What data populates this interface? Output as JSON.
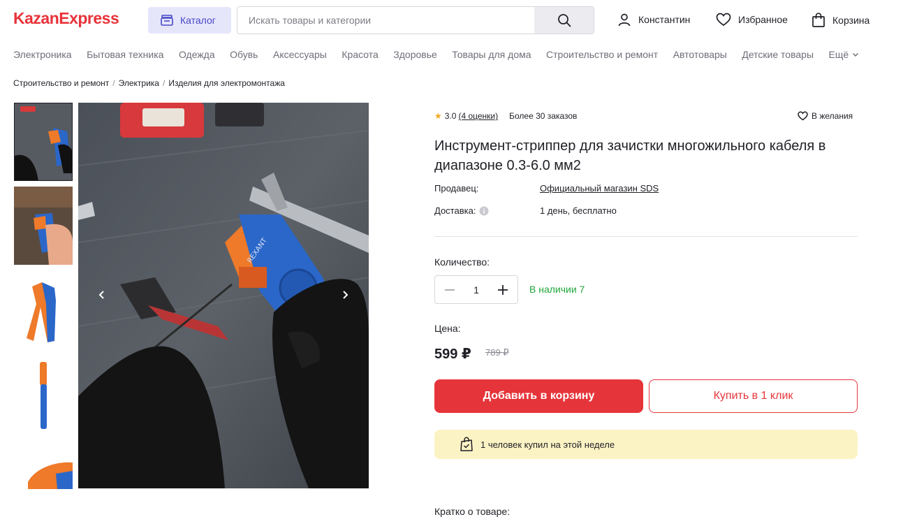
{
  "header": {
    "logo": "KazanExpress",
    "catalog_label": "Каталог",
    "search_placeholder": "Искать товары и категории",
    "user_label": "Константин",
    "favorites_label": "Избранное",
    "cart_label": "Корзина"
  },
  "nav": {
    "items": [
      "Электроника",
      "Бытовая техника",
      "Одежда",
      "Обувь",
      "Аксессуары",
      "Красота",
      "Здоровье",
      "Товары для дома",
      "Строительство и ремонт",
      "Автотовары",
      "Детские товары"
    ],
    "more_label": "Ещё"
  },
  "breadcrumb": [
    "Строительство и ремонт",
    "Электрика",
    "Изделия для электромонтажа"
  ],
  "product": {
    "rating": "3.0",
    "reviews": "(4 оценки)",
    "orders": "Более 30 заказов",
    "wishlist_label": "В желания",
    "title": "Инструмент-стриппер для зачистки многожильного кабеля в диапазоне 0.3-6.0 мм2",
    "seller_label": "Продавец:",
    "seller_value": "Официальный магазин SDS",
    "delivery_label": "Доставка:",
    "delivery_value": "1 день, бесплатно",
    "quantity_label": "Количество:",
    "quantity_value": "1",
    "stock": "В наличии 7",
    "price_label": "Цена:",
    "price": "599 ₽",
    "old_price": "789 ₽",
    "add_to_cart": "Добавить в корзину",
    "buy_one_click": "Купить в 1 клик",
    "bought_note": "1 человек купил на этой неделе",
    "short_about": "Кратко о товаре:",
    "photo_brand_text": "REXANT"
  },
  "colors": {
    "brand_red": "#e5353a",
    "catalog_bg": "#e6e6fb",
    "catalog_text": "#4747c7",
    "stock_green": "#1fa63a",
    "star": "#f2a81d",
    "notice_bg": "#fcf3c4"
  }
}
